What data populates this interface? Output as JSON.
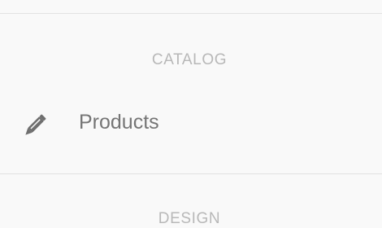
{
  "sidebar": {
    "sections": [
      {
        "title": "CATALOG"
      },
      {
        "title": "DESIGN"
      }
    ],
    "items": [
      {
        "label": "Products",
        "icon": "pencil-icon"
      }
    ]
  },
  "colors": {
    "background": "#f9f9f9",
    "divider": "#e2e2e2",
    "section_text": "#b8b8b8",
    "item_text": "#757575",
    "icon": "#6f6f6f"
  }
}
